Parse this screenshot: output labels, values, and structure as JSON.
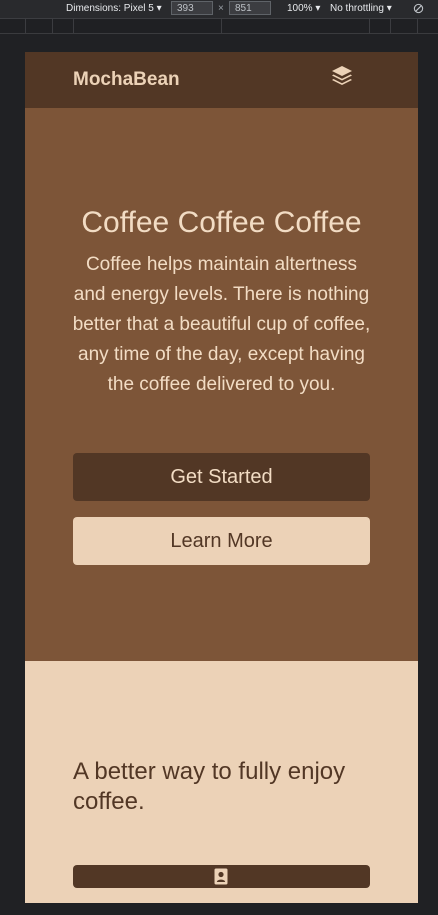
{
  "devtools": {
    "device_label": "Dimensions: Pixel 5",
    "width_value": "393",
    "times": "×",
    "height_value": "851",
    "zoom": "100%",
    "throttling": "No throttling",
    "dropdown_arrow": "▾"
  },
  "navbar": {
    "brand": "MochaBean",
    "menu_icon": "layers-icon"
  },
  "hero": {
    "title": "Coffee Coffee Coffee",
    "text": "Coffee helps maintain altertness and energy levels. There is nothing better that a beautiful cup of coffee, any time of the day, except having the coffee delivered to you.",
    "primary_button": "Get Started",
    "secondary_button": "Learn More"
  },
  "section2": {
    "title": "A better way to fully enjoy coffee.",
    "feature_icon": "contact-card-icon"
  },
  "colors": {
    "navbar_bg": "#523725",
    "hero_bg": "#7d5538",
    "cream": "#ecd2b7",
    "hero_text": "#f2dcc4"
  }
}
